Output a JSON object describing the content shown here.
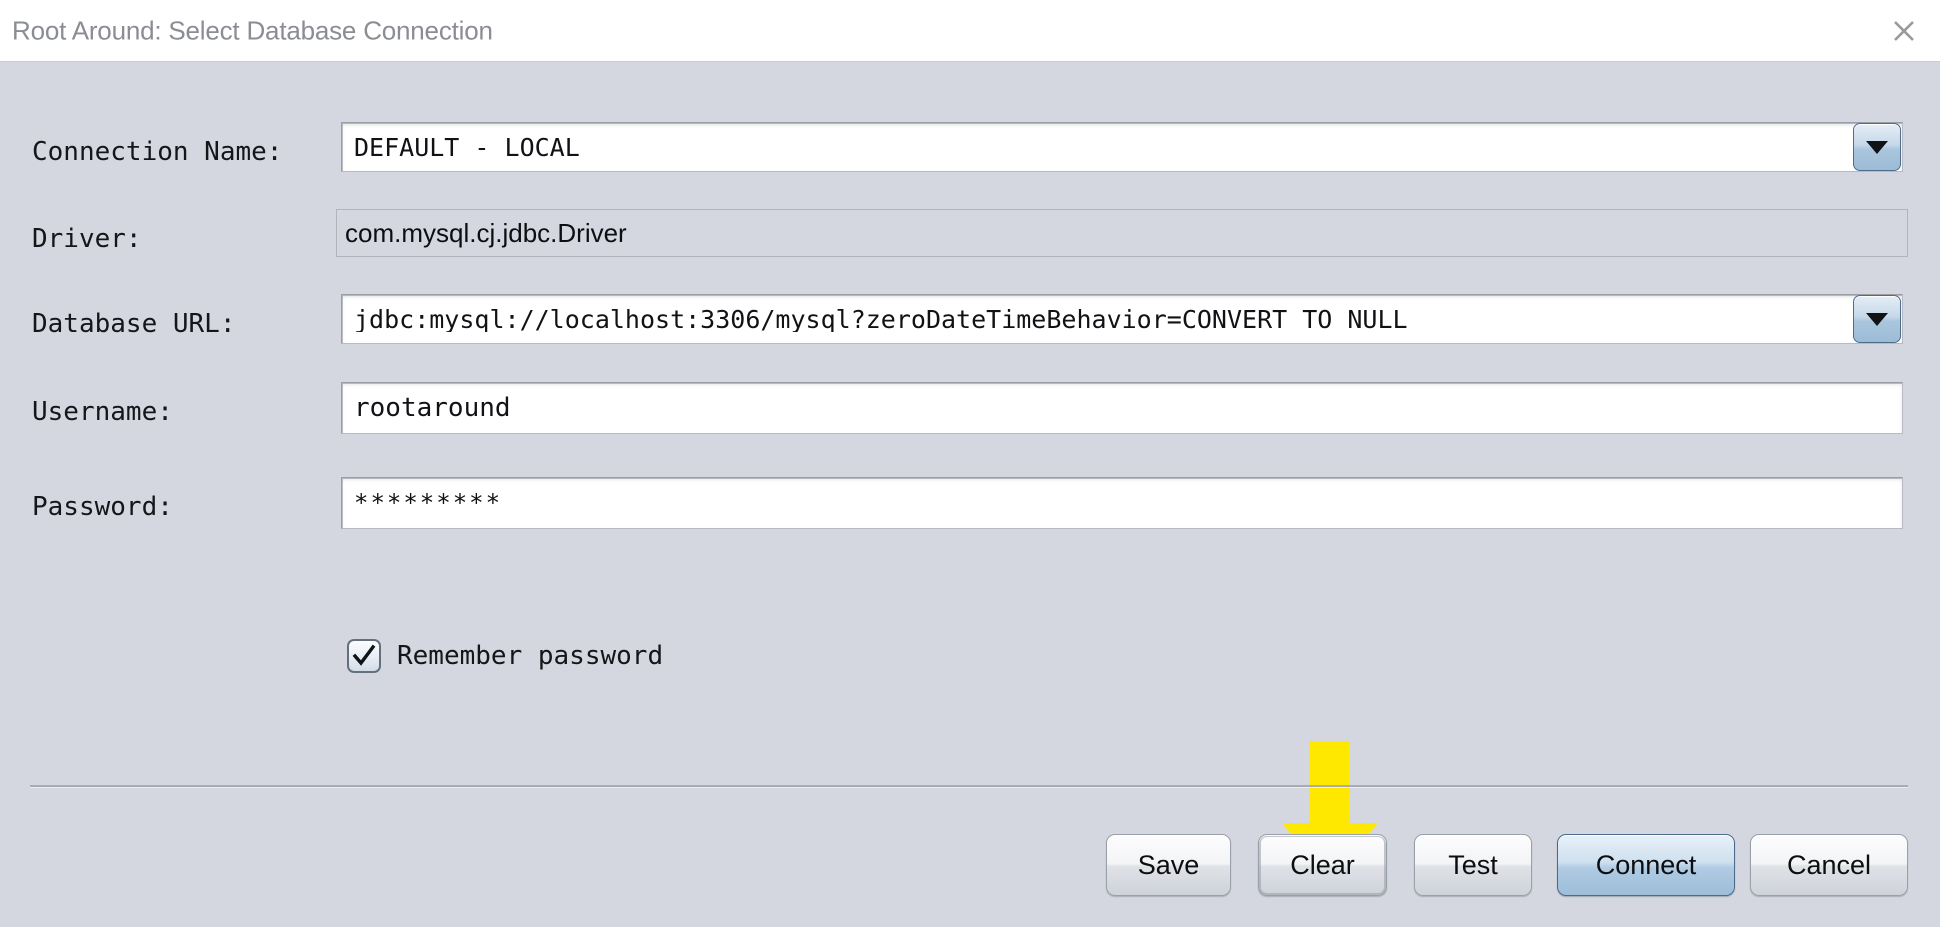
{
  "window": {
    "title": "Root Around: Select Database Connection",
    "close_icon": "close-icon",
    "background_color": "#d4d7df",
    "titlebar_color": "#ffffff",
    "title_text_color": "#8a8d93"
  },
  "form": {
    "connection_name": {
      "label": "Connection Name:",
      "value": "DEFAULT - LOCAL",
      "control": "combobox",
      "arrow_icon": "chevron-down-icon"
    },
    "driver": {
      "label": "Driver:",
      "value": "com.mysql.cj.jdbc.Driver",
      "control": "readonly-textfield"
    },
    "database_url": {
      "label": "Database URL:",
      "value": "jdbc:mysql://localhost:3306/mysql?zeroDateTimeBehavior=CONVERT_TO_NULL",
      "control": "combobox",
      "arrow_icon": "chevron-down-icon"
    },
    "username": {
      "label": "Username:",
      "value": "rootaround",
      "placeholder": "",
      "control": "textfield"
    },
    "password": {
      "label": "Password:",
      "value": "*********",
      "placeholder": "",
      "control": "passwordfield"
    },
    "remember_password": {
      "label": "Remember password",
      "checked": true,
      "check_icon": "check-icon"
    }
  },
  "annotation": {
    "shape": "down-arrow",
    "color": "#ffe800",
    "points_at": "Clear"
  },
  "buttons": [
    {
      "name": "save",
      "label": "Save",
      "default": false,
      "focused": false
    },
    {
      "name": "clear",
      "label": "Clear",
      "default": false,
      "focused": true
    },
    {
      "name": "test",
      "label": "Test",
      "default": false,
      "focused": false
    },
    {
      "name": "connect",
      "label": "Connect",
      "default": true,
      "focused": false
    },
    {
      "name": "cancel",
      "label": "Cancel",
      "default": false,
      "focused": false
    }
  ]
}
